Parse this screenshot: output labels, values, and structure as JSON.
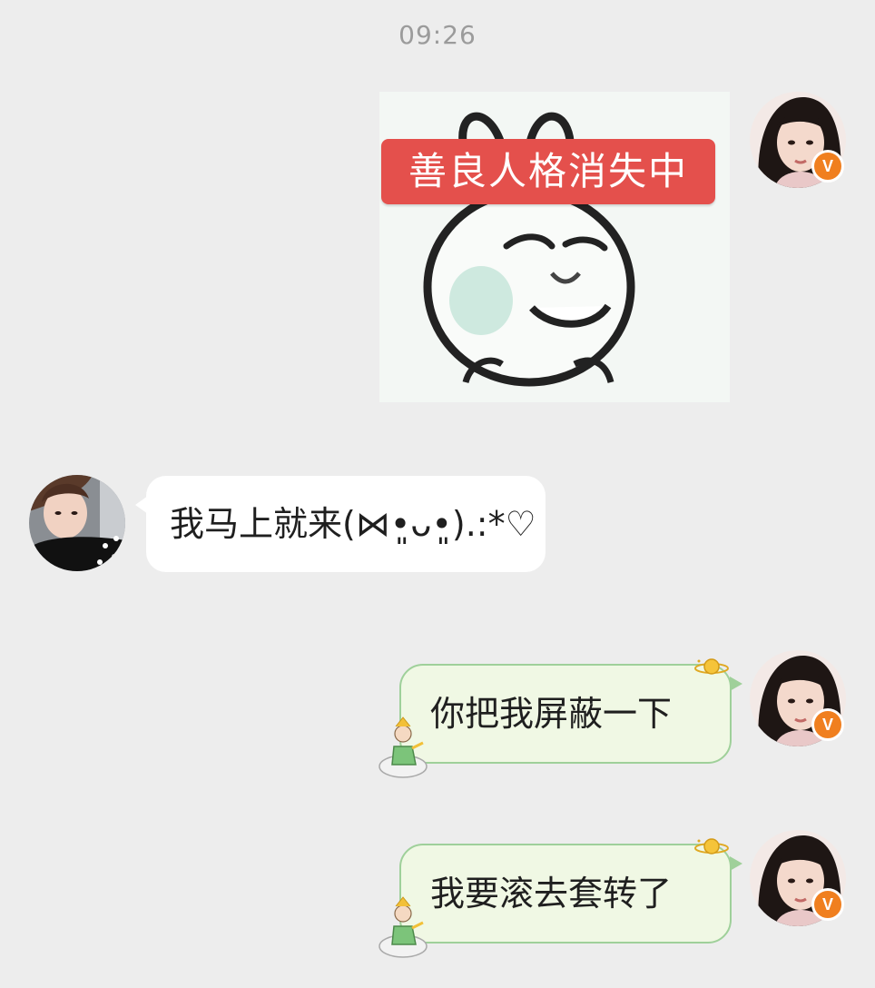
{
  "chat": {
    "timestamp": "09:26",
    "messages": [
      {
        "side": "right",
        "type": "sticker",
        "sticker_text": "善良人格消失中"
      },
      {
        "side": "left",
        "type": "text",
        "text": "我马上就来(⋈•͈ᴗ•͈).:*♡"
      },
      {
        "side": "right",
        "type": "text",
        "text": "你把我屏蔽一下"
      },
      {
        "side": "right",
        "type": "text",
        "text": "我要滚去套转了"
      }
    ]
  },
  "badges": {
    "verified_label": "V",
    "verified_color": "#f07f1f"
  },
  "colors": {
    "background": "#ededed",
    "right_bubble_fill": "#f0f8e4",
    "right_bubble_border": "#9fd09a",
    "left_bubble_fill": "#ffffff",
    "sticker_banner": "#e4504c"
  },
  "icons": [
    "verified-badge-icon",
    "planet-decoration-icon",
    "little-prince-decoration-icon"
  ]
}
